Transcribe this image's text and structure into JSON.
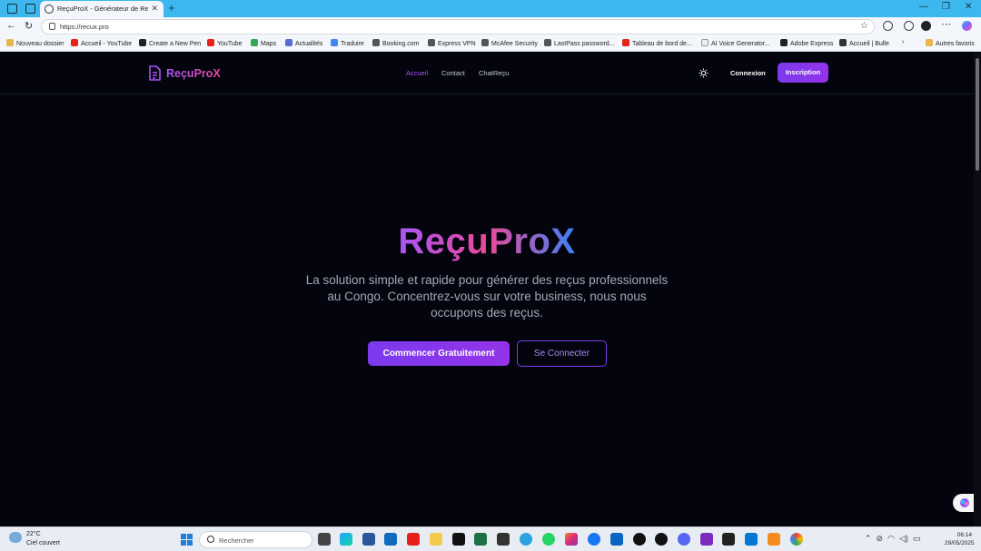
{
  "browser": {
    "tab_title": "ReçuProX - Générateur de Reçus",
    "url": "https://recux.pro"
  },
  "bookmarks": [
    {
      "label": "Nouveau dossier",
      "color": "#e8b64a"
    },
    {
      "label": "Accueil - YouTube",
      "color": "#e62117"
    },
    {
      "label": "Create a New Pen",
      "color": "#222222"
    },
    {
      "label": "YouTube",
      "color": "#e62117"
    },
    {
      "label": "Maps",
      "color": "#34a853"
    },
    {
      "label": "Actualités",
      "color": "#5b6bd5"
    },
    {
      "label": "Traduire",
      "color": "#4285f4"
    },
    {
      "label": "Booking.com",
      "color": "#555555"
    },
    {
      "label": "Express VPN",
      "color": "#555555"
    },
    {
      "label": "McAfee Security",
      "color": "#555555"
    },
    {
      "label": "LastPass password...",
      "color": "#555555"
    },
    {
      "label": "Tableau de bord de...",
      "color": "#e62117"
    },
    {
      "label": "AI Voice Generator...",
      "color": "#eeeeee"
    },
    {
      "label": "Adobe Express",
      "color": "#222222"
    },
    {
      "label": "Accueil | Bulle",
      "color": "#333333"
    },
    {
      "label": "Autres favoris",
      "color": "#e8b64a"
    }
  ],
  "site": {
    "logo": "ReçuProX",
    "nav": [
      "Accueil",
      "Contact",
      "ChatReçu"
    ],
    "login": "Connexion",
    "signup": "Inscription",
    "hero_title": "ReçuProX",
    "hero_subtitle": "La solution simple et rapide pour générer des reçus professionnels au Congo. Concentrez-vous sur votre business, nous nous occupons des reçus.",
    "cta_primary": "Commencer Gratuitement",
    "cta_secondary": "Se Connecter"
  },
  "taskbar": {
    "temperature": "22°C",
    "weather": "Ciel couvert",
    "search_placeholder": "Rechercher",
    "time": "06:14",
    "date": "29/05/2025"
  }
}
